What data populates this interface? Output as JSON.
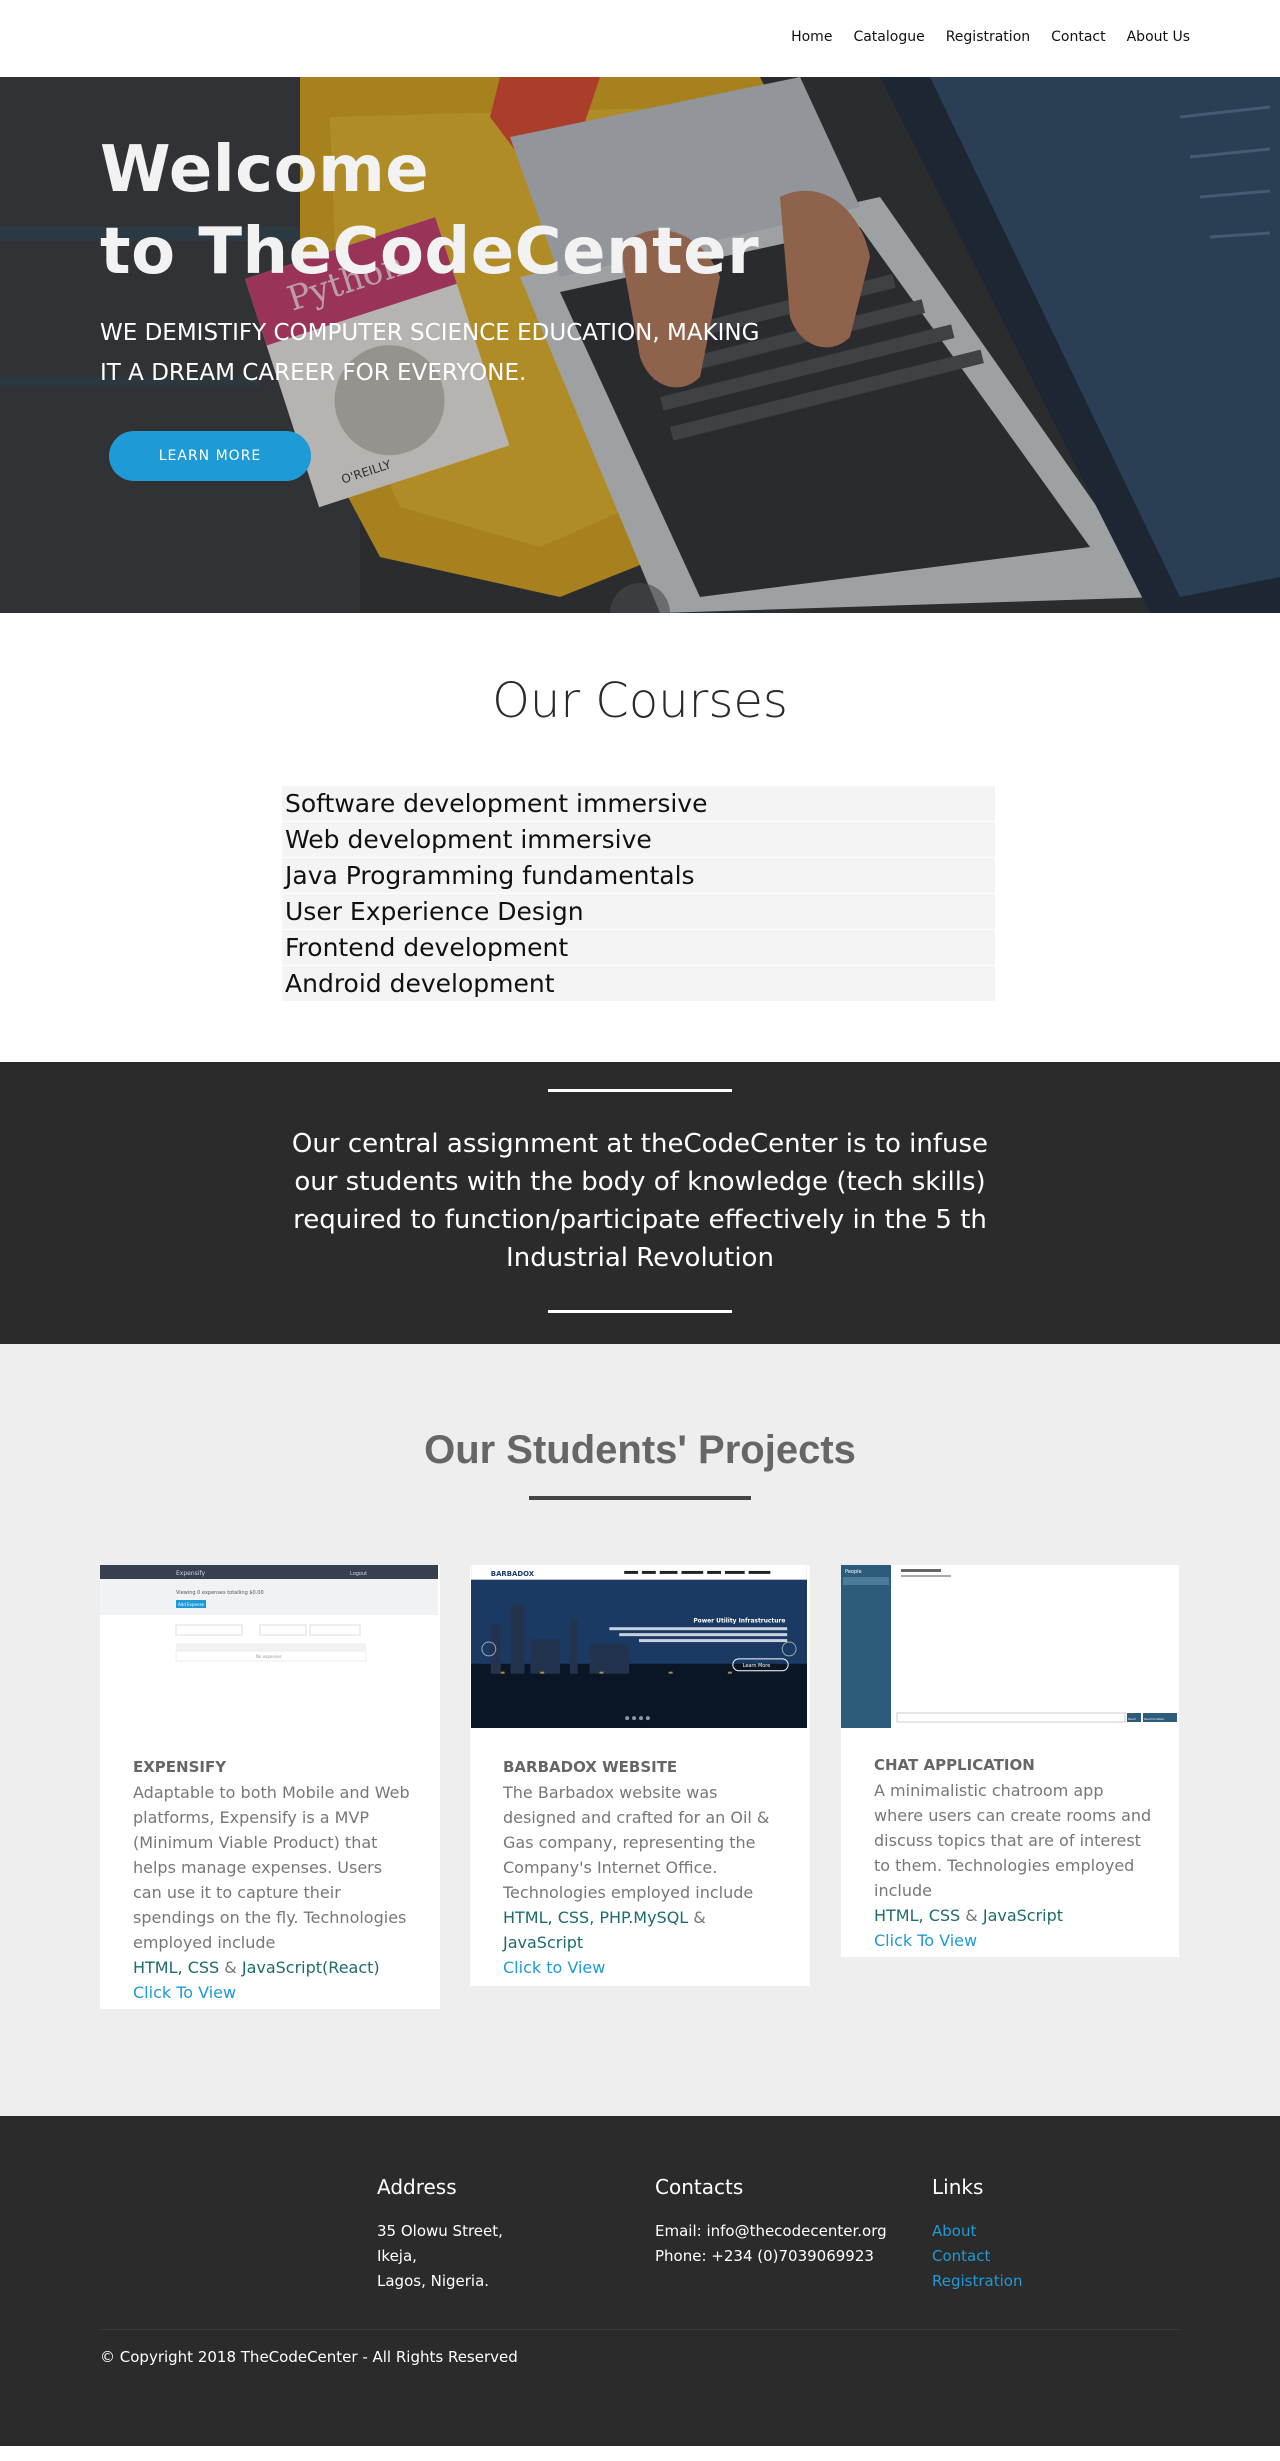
{
  "nav": {
    "items": [
      {
        "label": "Home"
      },
      {
        "label": "Catalogue"
      },
      {
        "label": "Registration"
      },
      {
        "label": "Contact"
      },
      {
        "label": "About Us"
      }
    ]
  },
  "hero": {
    "title_line1": "Welcome",
    "title_line2": "to TheCodeCenter",
    "tagline_line1": "WE DEMISTIFY COMPUTER SCIENCE EDUCATION, MAKING",
    "tagline_line2": "IT A DREAM CAREER FOR EVERYONE.",
    "cta_label": "LEARN MORE",
    "book_word": "Python",
    "book_publisher": "O'REILLY"
  },
  "courses": {
    "heading": "Our Courses",
    "items": [
      "Software development immersive",
      "Web development immersive",
      "Java Programming fundamentals",
      "User Experience Design",
      "Frontend development",
      "Android development"
    ]
  },
  "mission": {
    "text": "Our central assignment at theCodeCenter is to infuse our students with the body of knowledge (tech skills) required to function/participate effectively in the 5 th Industrial Revolution"
  },
  "projects": {
    "heading": "Our Students' Projects",
    "cards": [
      {
        "title": "EXPENSIFY",
        "description": "Adaptable to both Mobile and Web platforms, Expensify is a MVP (Minimum Viable Product) that helps manage expenses. Users can use it to capture their spendings on the fly. Technologies employed include",
        "tech_a": "HTML",
        "tech_sep": ", ",
        "tech_b": "CSS",
        "amp": " & ",
        "tech_c": "JavaScript(React)",
        "view_label": "Click To View",
        "shot_app_name": "Expensify",
        "shot_logout": "Logout",
        "shot_summary": "Viewing 0 expenses totalling $0.00",
        "shot_button": "Add Expense",
        "shot_empty": "No expenses"
      },
      {
        "title": "BARBADOX WEBSITE",
        "description": "The Barbadox website was designed and crafted for an Oil & Gas company, representing the Company's Internet Office. Technologies employed include",
        "tech_a": "HTML",
        "tech_sep": ", ",
        "tech_b": "CSS",
        "tech_sep2": ", ",
        "tech_c": "PHP.MySQL",
        "amp": " & ",
        "tech_d": "JavaScript",
        "view_label": "Click to View",
        "shot_brand": "BARBADOX",
        "shot_headline": "Power Utility Infrastructure",
        "shot_button": "Learn More"
      },
      {
        "title": "CHAT APPLICATION",
        "description": "A minimalistic chatroom app where users can create rooms and discuss topics that are of interest to them. Technologies employed include",
        "tech_a": "HTML",
        "tech_sep": ", ",
        "tech_b": "CSS",
        "amp": " & ",
        "tech_c": "JavaScript",
        "view_label": "Click To View",
        "shot_sidebar_title": "People",
        "shot_send": "Send",
        "shot_location": "Send location"
      }
    ]
  },
  "footer": {
    "address_heading": "Address",
    "address_lines": [
      "35 Olowu Street,",
      "Ikeja,",
      "Lagos, Nigeria."
    ],
    "contacts_heading": "Contacts",
    "email": "Email: info@thecodecenter.org",
    "phone": "Phone: +234 (0)7039069923",
    "links_heading": "Links",
    "links": [
      "About",
      "Contact",
      "Registration"
    ],
    "copyright": "© Copyright 2018 TheCodeCenter - All Rights Reserved"
  },
  "colors": {
    "accent": "#1e9ad6",
    "dark_band": "#2b2b2b",
    "tech_text": "#1e6b6e"
  }
}
